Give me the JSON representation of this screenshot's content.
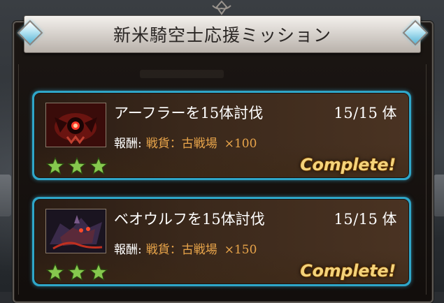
{
  "header": {
    "title": "新米騎空士応援ミッション"
  },
  "missions": [
    {
      "title": "アーフラーを15体討伐",
      "count": "15/15",
      "unit": "体",
      "reward_label": "報酬:",
      "reward_item": "戦貨：古戦場",
      "reward_mult": "×100",
      "stars": 3,
      "status": "Complete!",
      "thumb_icon": "red-beast-monster-portrait"
    },
    {
      "title": "ベオウルフを15体討伐",
      "count": "15/15",
      "unit": "体",
      "reward_label": "報酬:",
      "reward_item": "戦貨：古戦場",
      "reward_mult": "×150",
      "stars": 3,
      "status": "Complete!",
      "thumb_icon": "dark-wolf-monster-portrait"
    }
  ],
  "colors": {
    "card_border": "#2fa6c8",
    "reward_text": "#e9a54a",
    "complete_text": "#f4d37a",
    "star": "#7ec24a"
  }
}
